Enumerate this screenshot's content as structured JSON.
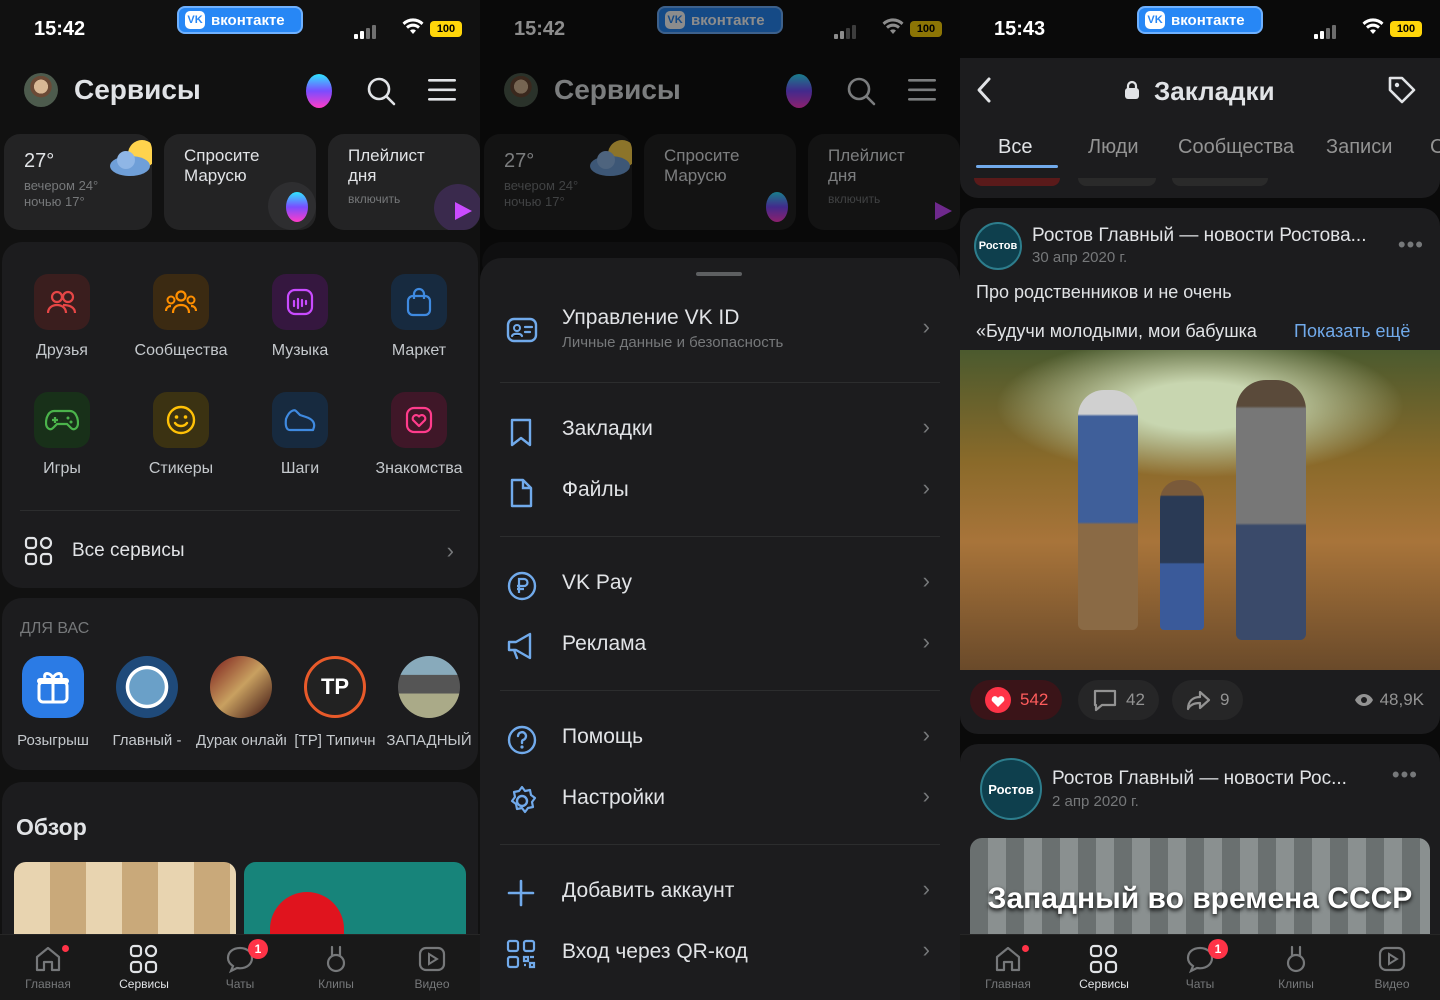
{
  "status": [
    {
      "time": "15:42",
      "vk_label": "вконтакте",
      "battery": "100"
    },
    {
      "time": "15:42",
      "vk_label": "вконтакте",
      "battery": "100"
    },
    {
      "time": "15:43",
      "vk_label": "вконтакте",
      "battery": "100"
    }
  ],
  "services": {
    "title": "Сервисы",
    "weather": {
      "temp": "27°",
      "evening": "вечером 24°",
      "night": "ночью 17°"
    },
    "marusia_widget": "Спросите\nМарусю",
    "playlist": {
      "title": "Плейлист\nдня",
      "sub": "включить"
    },
    "grid": [
      {
        "label": "Друзья",
        "icon": "friends-icon",
        "color": "#e64646"
      },
      {
        "label": "Сообщества",
        "icon": "communities-icon",
        "color": "#ff8f00"
      },
      {
        "label": "Музыка",
        "icon": "music-icon",
        "color": "#c94bff"
      },
      {
        "label": "Маркет",
        "icon": "market-icon",
        "color": "#3f8ae0"
      },
      {
        "label": "Игры",
        "icon": "games-icon",
        "color": "#4bb34b"
      },
      {
        "label": "Стикеры",
        "icon": "stickers-icon",
        "color": "#ffc107"
      },
      {
        "label": "Шаги",
        "icon": "steps-icon",
        "color": "#3f8ae0"
      },
      {
        "label": "Знакомства",
        "icon": "dating-icon",
        "color": "#ff3c8c"
      }
    ],
    "all_services": "Все сервисы",
    "for_you_title": "ДЛЯ ВАС",
    "apps": [
      "Розыгрыш",
      "Главный -",
      "Дурак онлайн",
      "[TP] Типичн",
      "ЗАПАДНЫЙ"
    ],
    "overview_title": "Обзор"
  },
  "menu": {
    "items": [
      {
        "title": "Управление VK ID",
        "sub": "Личные данные и безопасность",
        "icon": "id-card-icon"
      },
      {
        "title": "Закладки",
        "icon": "bookmark-icon"
      },
      {
        "title": "Файлы",
        "icon": "file-icon"
      },
      {
        "title": "VK Pay",
        "icon": "vkpay-icon"
      },
      {
        "title": "Реклама",
        "icon": "megaphone-icon"
      },
      {
        "title": "Помощь",
        "icon": "help-icon"
      },
      {
        "title": "Настройки",
        "icon": "settings-icon"
      },
      {
        "title": "Добавить аккаунт",
        "icon": "plus-icon"
      },
      {
        "title": "Вход через QR-код",
        "icon": "qr-icon"
      }
    ]
  },
  "bookmarks": {
    "title": "Закладки",
    "tabs": [
      "Все",
      "Люди",
      "Сообщества",
      "Записи",
      "С"
    ],
    "post1": {
      "author": "Ростов Главный — новости Ростова...",
      "date": "30 апр 2020 г.",
      "avatar_text": "Ростов",
      "text1": "Про родственников и не очень",
      "text2": "«Будучи молодыми, мои бабушка",
      "more": "Показать ещё",
      "likes": "542",
      "comments": "42",
      "shares": "9",
      "views": "48,9K"
    },
    "post2": {
      "author": "Ростов Главный — новости Рос...",
      "date": "2 апр 2020 г.",
      "avatar_text": "Ростов",
      "image_caption": "Западный во времена СССР"
    }
  },
  "tabbar": [
    "Главная",
    "Сервисы",
    "Чаты",
    "Клипы",
    "Видео"
  ],
  "chats_badge": "1",
  "colors": {
    "accent": "#71aaeb",
    "like": "#ff3347",
    "bg": "#111111",
    "card": "#1c1c1e"
  }
}
